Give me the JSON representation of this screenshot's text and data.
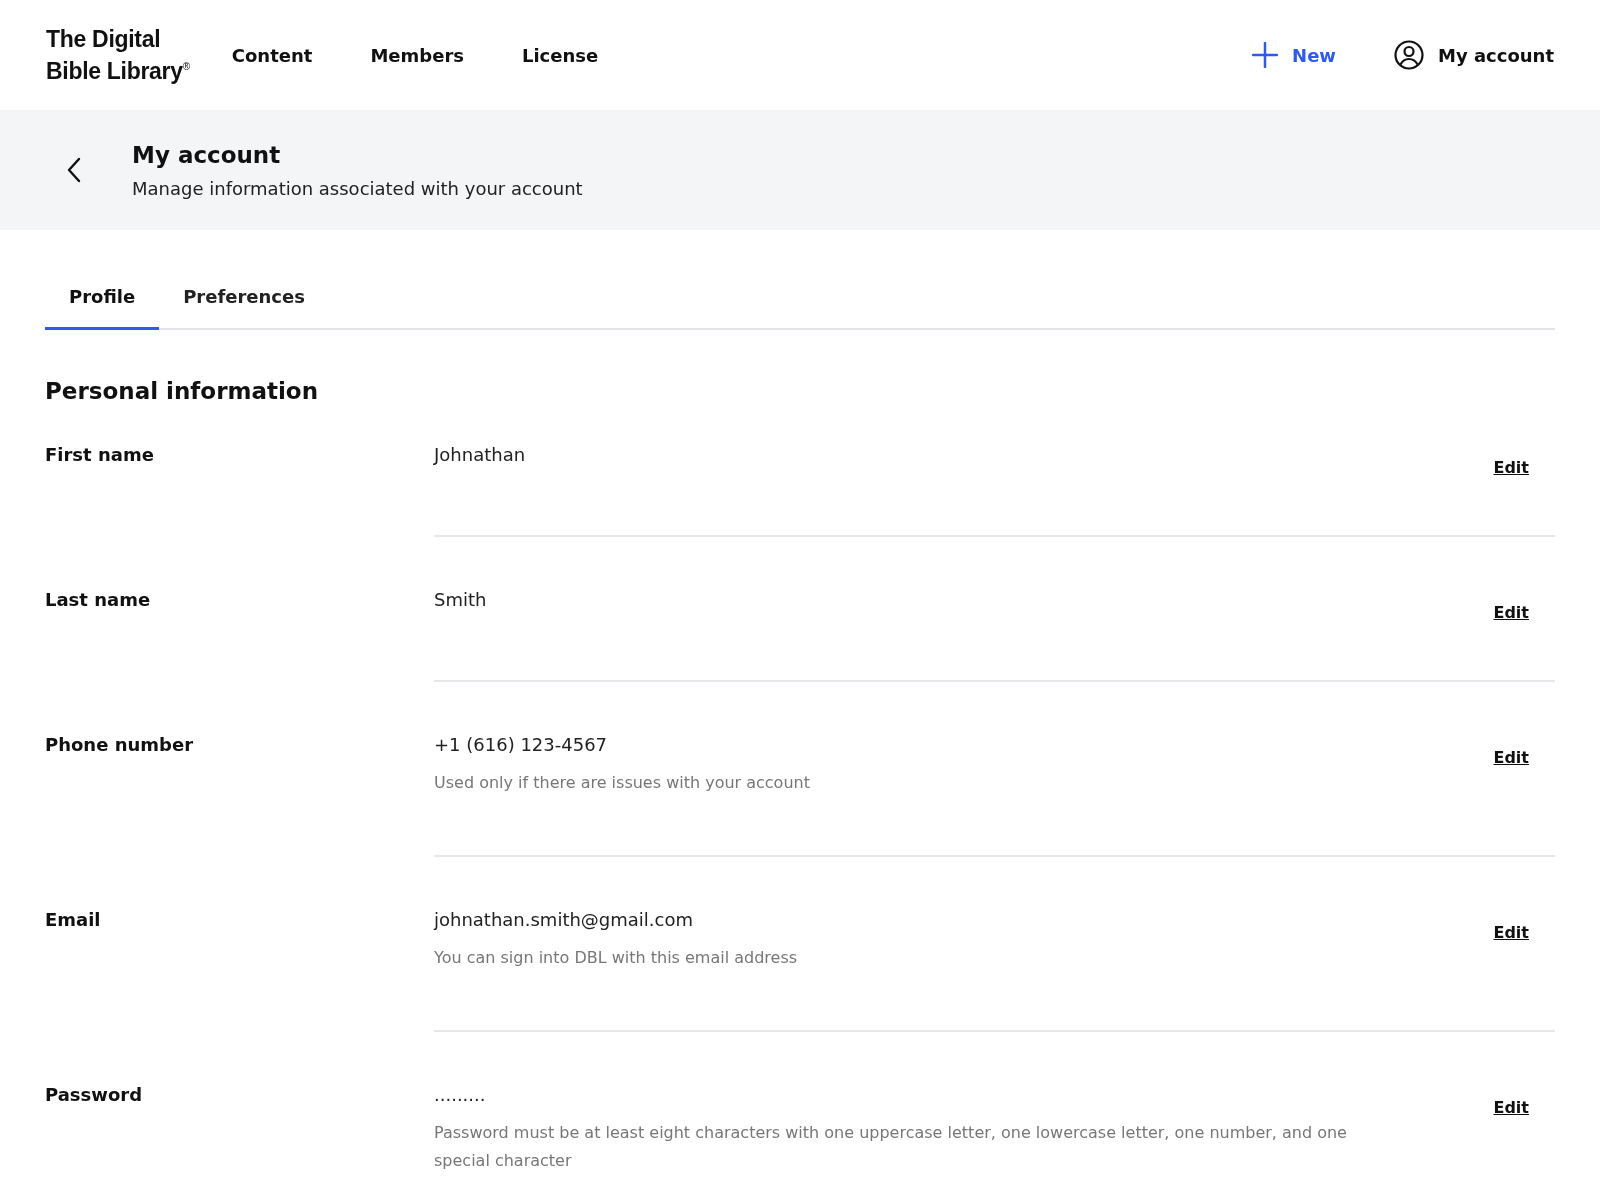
{
  "header": {
    "logo_lines": [
      "The Digital",
      "Bible Library$^{®}$"
    ],
    "nav": [
      {
        "label": "Content"
      },
      {
        "label": "Members"
      },
      {
        "label": "License"
      }
    ],
    "new_button": "New",
    "account_button": "My account"
  },
  "page_header": {
    "title": "My account",
    "subtitle": "Manage information associated with your account"
  },
  "tabs": [
    {
      "label": "Profile",
      "selected": true
    },
    {
      "label": "Preferences",
      "selected": false
    }
  ],
  "section_title": "Personal information",
  "fields": [
    {
      "label": "First name",
      "value": "Johnathan",
      "action": "Edit"
    },
    {
      "label": "Last name",
      "value": "Smith",
      "action": "Edit"
    },
    {
      "label": "Phone number",
      "value": "+1 (616) 123-4567",
      "hint": "Used only if there are issues with your account",
      "action": "Edit"
    },
    {
      "label": "Email",
      "value": "johnathan.smith@gmail.com",
      "hint": "You can sign into DBL with this email address",
      "action": "Edit"
    },
    {
      "label": "Password",
      "value": ".........",
      "hint": "Password must be at least eight characters with one uppercase letter, one lowercase letter, one number, and one special character",
      "action": "Edit"
    }
  ]
}
